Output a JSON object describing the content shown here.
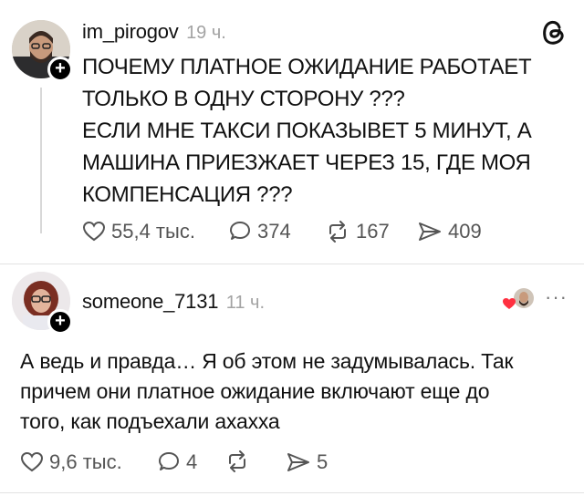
{
  "post": {
    "username": "im_pirogov",
    "time": "19 ч.",
    "text_lines": [
      "ПОЧЕМУ ПЛАТНОЕ ОЖИДАНИЕ РАБОТАЕТ",
      "ТОЛЬКО В ОДНУ СТОРОНУ ???",
      "ЕСЛИ МНЕ ТАКСИ ПОКАЗЫВЕТ 5 МИНУТ, А",
      "МАШИНА ПРИЕЗЖАЕТ ЧЕРЕЗ 15, ГДЕ МОЯ",
      "КОМПЕНСАЦИЯ ???"
    ],
    "likes": "55,4 тыс.",
    "comments": "374",
    "reposts": "167",
    "shares": "409",
    "logo_icon": "threads-logo-icon"
  },
  "reply": {
    "username": "someone_7131",
    "time": "11 ч.",
    "text_lines": [
      "А ведь и правда… Я об этом не задумывалась. Так",
      "причем они платное ожидание включают еще до",
      "того, как подъехали ахахха"
    ],
    "likes": "9,6 тыс.",
    "comments": "4",
    "reposts": "",
    "shares": "5",
    "more_label": "···",
    "liked_by_author_icon": "heart-with-avatar-icon"
  },
  "colors": {
    "text": "#111111",
    "muted": "#a3a3a3",
    "icon": "#555555",
    "heart": "#ff3040"
  }
}
